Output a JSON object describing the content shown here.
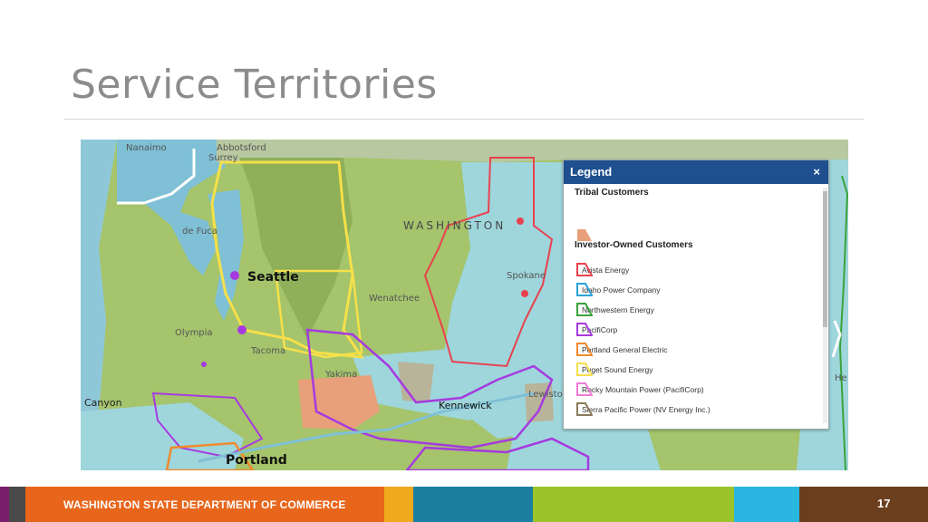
{
  "slide": {
    "title": "Service Territories",
    "footer_text": "WASHINGTON STATE DEPARTMENT OF COMMERCE",
    "page_number": "17"
  },
  "map": {
    "labels": {
      "nanaimo": "Nanaimo",
      "abbotsford": "Abbotsford",
      "surrey": "Surrey",
      "juan_de_fuca": "de Fuca",
      "seattle": "Seattle",
      "olympia": "Olympia",
      "tacoma": "Tacoma",
      "wenatchee": "Wenatchee",
      "washington": "WASHINGTON",
      "spokane": "Spokane",
      "yakima": "Yakima",
      "kennewick": "Kennewick",
      "portland": "Portland",
      "canyon": "Canyon",
      "lewiston": "Lewiston",
      "helena": "He"
    }
  },
  "legend": {
    "title": "Legend",
    "close": "×",
    "tribal_heading": "Tribal Customers",
    "iou_heading": "Investor-Owned Customers",
    "items": [
      {
        "label": "Avista Energy",
        "color": "#e8424f"
      },
      {
        "label": "Idaho Power Company",
        "color": "#2aa3d8"
      },
      {
        "label": "Northwestern Energy",
        "color": "#3aa33a"
      },
      {
        "label": "PacifiCorp",
        "color": "#a63ae0"
      },
      {
        "label": "Portland General Electric",
        "color": "#f08a2c"
      },
      {
        "label": "Puget Sound Energy",
        "color": "#f5e04a"
      },
      {
        "label": "Rocky Mountain Power (PacifiCorp)",
        "color": "#f07ad8"
      },
      {
        "label": "Sierra Pacific Power (NV Energy Inc.)",
        "color": "#8a7a5a"
      }
    ],
    "tribal_color": "#e8a07a"
  },
  "colors": {
    "footer": [
      "#7a1f6b",
      "#4a4a4a",
      "#e8661c",
      "#f0a81c",
      "#1a7fa0",
      "#9cc42a",
      "#29b6e0",
      "#6b3f1e"
    ]
  }
}
